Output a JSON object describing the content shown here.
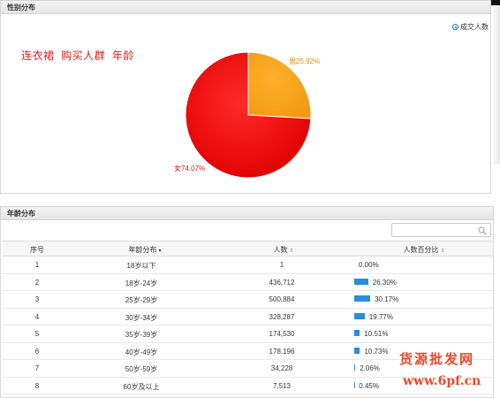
{
  "gender_panel": {
    "title": "性别分布",
    "legend_label": "成交人数",
    "annotation": "连衣裙  购买人群  年龄",
    "slices": [
      {
        "label": "男25.92%",
        "value": 25.92,
        "color": "#f7a21c"
      },
      {
        "label": "女74.07%",
        "value": 74.07,
        "color": "#ee1111"
      }
    ]
  },
  "age_panel": {
    "title": "年龄分布",
    "columns": [
      "序号",
      "年龄分布",
      "人数",
      "人数百分比"
    ],
    "rows": [
      {
        "idx": "1",
        "age": "18岁以下",
        "count": "1",
        "pct": "0.00%",
        "pct_value": 0.0
      },
      {
        "idx": "2",
        "age": "18岁-24岁",
        "count": "436,712",
        "pct": "26.30%",
        "pct_value": 26.3
      },
      {
        "idx": "3",
        "age": "25岁-29岁",
        "count": "500,884",
        "pct": "30.17%",
        "pct_value": 30.17
      },
      {
        "idx": "4",
        "age": "30岁-34岁",
        "count": "328,287",
        "pct": "19.77%",
        "pct_value": 19.77
      },
      {
        "idx": "5",
        "age": "35岁-39岁",
        "count": "174,530",
        "pct": "10.51%",
        "pct_value": 10.51
      },
      {
        "idx": "6",
        "age": "40岁-49岁",
        "count": "178,196",
        "pct": "10.73%",
        "pct_value": 10.73
      },
      {
        "idx": "7",
        "age": "50岁-59岁",
        "count": "34,228",
        "pct": "2.06%",
        "pct_value": 2.06
      },
      {
        "idx": "8",
        "age": "60岁及以上",
        "count": "7,513",
        "pct": "0.45%",
        "pct_value": 0.45
      }
    ]
  },
  "watermark": {
    "line1": "货源批发网",
    "line2": "www.6pf.cn"
  },
  "colors": {
    "bar": "#2a8dd6",
    "annotation": "#e32020",
    "watermark": "#e84a2a"
  }
}
